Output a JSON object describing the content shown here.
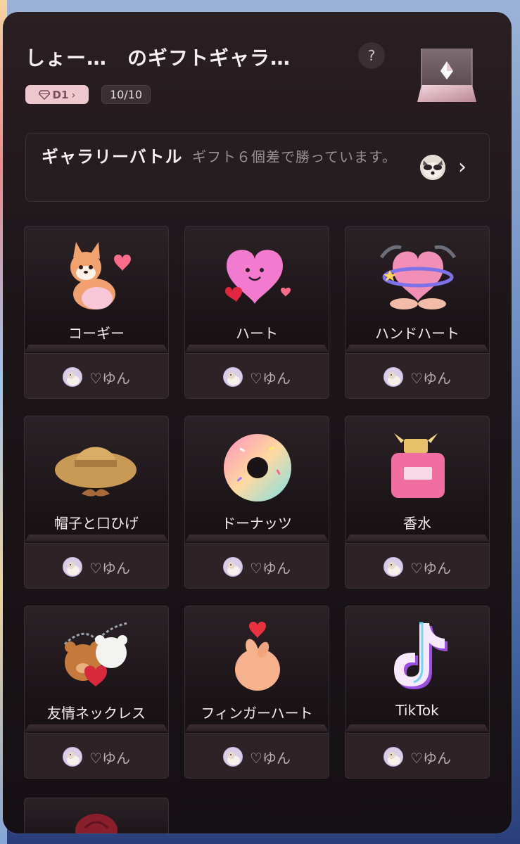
{
  "header": {
    "title": "しょー…　のギフトギャラ…",
    "help_icon": "question-icon",
    "level_badge": "D1",
    "count_badge": "10/10"
  },
  "battle": {
    "title": "ギャラリーバトル",
    "status": "ギフト６個差で勝っています。"
  },
  "gifts": [
    {
      "name": "コーギー",
      "sender": "♡ゆん",
      "icon": "corgi-icon"
    },
    {
      "name": "ハート",
      "sender": "♡ゆん",
      "icon": "heart-icon"
    },
    {
      "name": "ハンドハート",
      "sender": "♡ゆん",
      "icon": "hand-heart-icon"
    },
    {
      "name": "帽子と口ひげ",
      "sender": "♡ゆん",
      "icon": "hat-mustache-icon"
    },
    {
      "name": "ドーナッツ",
      "sender": "♡ゆん",
      "icon": "donut-icon"
    },
    {
      "name": "香水",
      "sender": "♡ゆん",
      "icon": "perfume-icon"
    },
    {
      "name": "友情ネックレス",
      "sender": "♡ゆん",
      "icon": "friendship-necklace-icon"
    },
    {
      "name": "フィンガーハート",
      "sender": "♡ゆん",
      "icon": "finger-heart-icon"
    },
    {
      "name": "TikTok",
      "sender": "♡ゆん",
      "icon": "tiktok-icon"
    }
  ],
  "colors": {
    "panel_bg": "#1d1619",
    "badge_pink": "#efc7cf",
    "text_primary": "#f4eef0",
    "text_muted": "#9a8f93"
  }
}
